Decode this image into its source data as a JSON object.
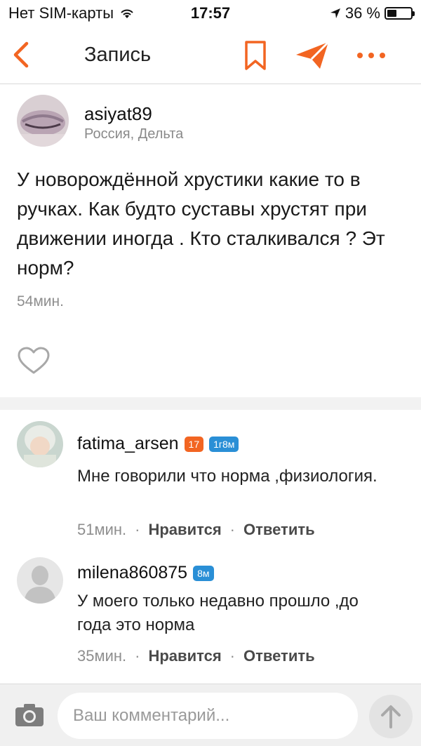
{
  "status_bar": {
    "carrier": "Нет SIM-карты",
    "time": "17:57",
    "battery_percent": "36 %",
    "battery_level": 0.36
  },
  "nav": {
    "title": "Запись",
    "accent_color": "#f26522"
  },
  "post": {
    "author": "asiyat89",
    "location": "Россия, Дельта",
    "text": "У новорождённой хрустики какие то в ручках. Как будто суставы хрустят при движении иногда . Кто сталкивался ? Эт норм?",
    "time": "54мин."
  },
  "comments": [
    {
      "author": "fatima_arsen",
      "badges": [
        "17",
        "1г8м"
      ],
      "text": "Мне говорили что норма ,физиология.",
      "time": "51мин.",
      "like_label": "Нравится",
      "reply_label": "Ответить"
    },
    {
      "author": "milena860875",
      "badges": [
        "8м"
      ],
      "text": "У моего только недавно прошло ,до года это норма",
      "time": "35мин.",
      "like_label": "Нравится",
      "reply_label": "Ответить"
    }
  ],
  "input": {
    "placeholder": "Ваш комментарий..."
  }
}
